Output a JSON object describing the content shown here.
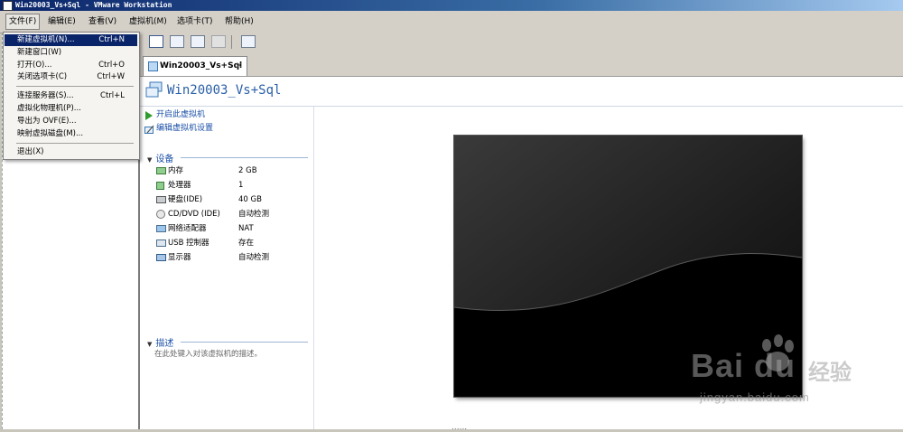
{
  "window": {
    "title": "Win20003_Vs+Sql - VMware Workstation"
  },
  "menubar": {
    "items": [
      {
        "label": "文件(F)"
      },
      {
        "label": "编辑(E)"
      },
      {
        "label": "查看(V)"
      },
      {
        "label": "虚拟机(M)"
      },
      {
        "label": "选项卡(T)"
      },
      {
        "label": "帮助(H)"
      }
    ]
  },
  "file_menu": {
    "items": [
      {
        "label": "新建虚拟机(N)...",
        "shortcut": "Ctrl+N"
      },
      {
        "label": "新建窗口(W)",
        "shortcut": ""
      },
      {
        "label": "打开(O)...",
        "shortcut": "Ctrl+O"
      },
      {
        "label": "关闭选项卡(C)",
        "shortcut": "Ctrl+W"
      },
      {
        "label": "连接服务器(S)...",
        "shortcut": "Ctrl+L"
      },
      {
        "label": "虚拟化物理机(P)...",
        "shortcut": ""
      },
      {
        "label": "导出为 OVF(E)...",
        "shortcut": ""
      },
      {
        "label": "映射虚拟磁盘(M)...",
        "shortcut": ""
      },
      {
        "label": "退出(X)",
        "shortcut": ""
      }
    ]
  },
  "tab": {
    "label": "Win20003_Vs+Sql",
    "close": "×"
  },
  "vm": {
    "name": "Win20003_Vs+Sql"
  },
  "commands": {
    "power_on": "开启此虚拟机",
    "edit_settings": "编辑虚拟机设置"
  },
  "devices": {
    "heading": "设备",
    "rows": [
      {
        "name": "内存",
        "value": "2 GB"
      },
      {
        "name": "处理器",
        "value": "1"
      },
      {
        "name": "硬盘(IDE)",
        "value": "40 GB"
      },
      {
        "name": "CD/DVD (IDE)",
        "value": "自动检测"
      },
      {
        "name": "网络适配器",
        "value": "NAT"
      },
      {
        "name": "USB 控制器",
        "value": "存在"
      },
      {
        "name": "显示器",
        "value": "自动检测"
      }
    ]
  },
  "description": {
    "heading": "描述",
    "placeholder": "在此处键入对该虚拟机的描述。"
  },
  "watermark": {
    "brand": "Bai du",
    "cn": "经验",
    "url": "jingyan.baidu.com"
  }
}
